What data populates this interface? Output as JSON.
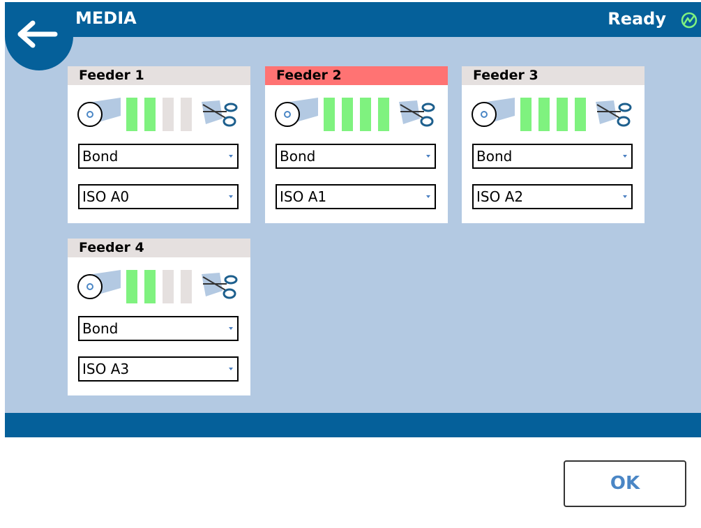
{
  "header": {
    "title": "MEDIA",
    "status": "Ready",
    "back_icon": "arrow-left-icon",
    "status_icon": "power-ready-icon"
  },
  "colors": {
    "header_bg": "#05609a",
    "panel_bg": "#b3c9e2",
    "card_header_bg": "#e5e0df",
    "card_header_alert_bg": "#ff7373",
    "level_full": "#7ff27f",
    "level_empty": "#e5e0df",
    "ok_text": "#4a86c5"
  },
  "feeders": [
    {
      "name": "Feeder 1",
      "alert": false,
      "level": 2,
      "level_max": 4,
      "media_type": "Bond",
      "media_size": "ISO A0"
    },
    {
      "name": "Feeder 2",
      "alert": true,
      "level": 4,
      "level_max": 4,
      "media_type": "Bond",
      "media_size": "ISO A1"
    },
    {
      "name": "Feeder 3",
      "alert": false,
      "level": 4,
      "level_max": 4,
      "media_type": "Bond",
      "media_size": "ISO A2"
    },
    {
      "name": "Feeder 4",
      "alert": false,
      "level": 2,
      "level_max": 4,
      "media_type": "Bond",
      "media_size": "ISO A3"
    }
  ],
  "footer": {
    "ok_label": "OK"
  }
}
